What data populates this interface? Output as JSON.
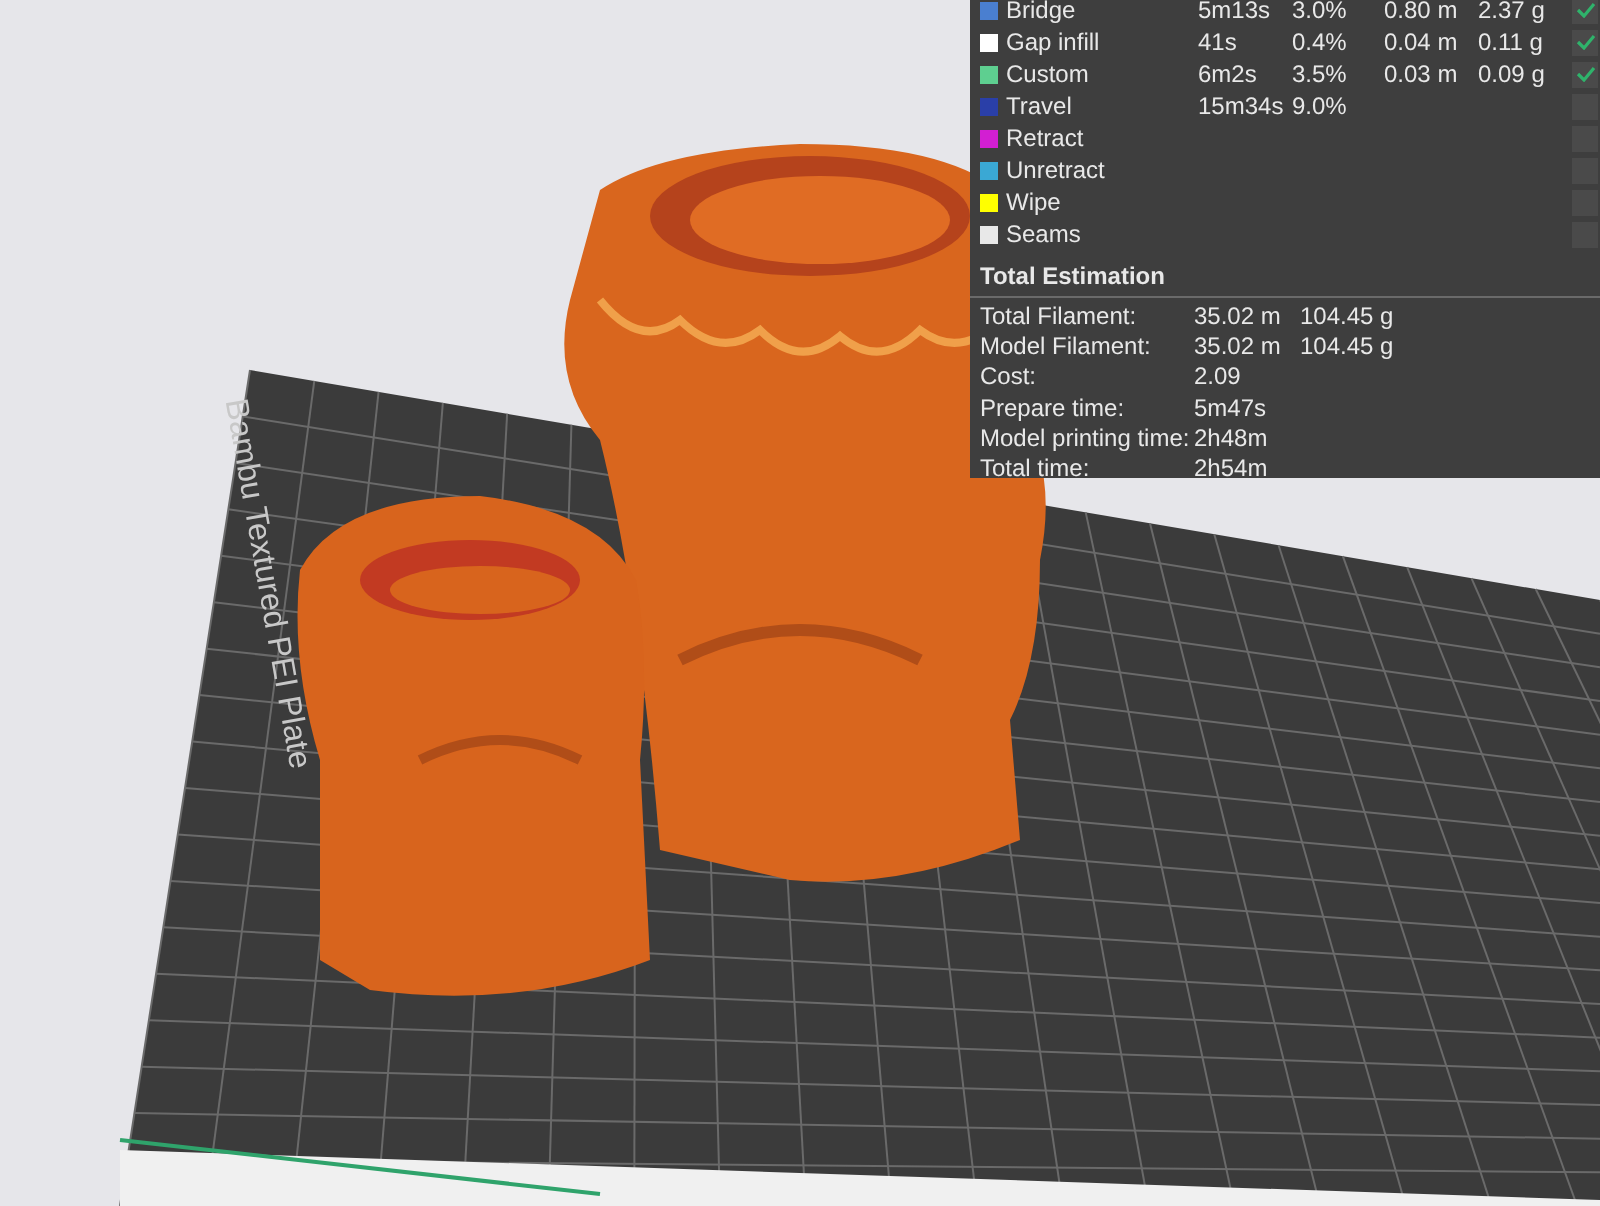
{
  "viewport": {
    "plate_label": "Bambu Textured PEI Plate"
  },
  "legend": {
    "rows": [
      {
        "name": "Bridge",
        "color": "#4a7fd0",
        "time": "5m13s",
        "percent": "3.0%",
        "length": "0.80 m",
        "weight": "2.37 g",
        "checked": true
      },
      {
        "name": "Gap infill",
        "color": "#ffffff",
        "time": "41s",
        "percent": "0.4%",
        "length": "0.04 m",
        "weight": "0.11 g",
        "checked": true
      },
      {
        "name": "Custom",
        "color": "#5ecf90",
        "time": "6m2s",
        "percent": "3.5%",
        "length": "0.03 m",
        "weight": "0.09 g",
        "checked": true
      },
      {
        "name": "Travel",
        "color": "#2a3fa8",
        "time": "15m34s",
        "percent": "9.0%",
        "checked": false
      },
      {
        "name": "Retract",
        "color": "#d21fd2",
        "checked": false
      },
      {
        "name": "Unretract",
        "color": "#3aa8d4",
        "checked": false
      },
      {
        "name": "Wipe",
        "color": "#ffff00",
        "checked": false
      },
      {
        "name": "Seams",
        "color": "#e8e8e8",
        "checked": false
      }
    ]
  },
  "total_estimation": {
    "title": "Total Estimation",
    "rows": [
      {
        "label": "Total Filament:",
        "value": "35.02 m",
        "weight": "104.45 g"
      },
      {
        "label": "Model Filament:",
        "value": "35.02 m",
        "weight": "104.45 g"
      },
      {
        "label": "Cost:",
        "value": "2.09"
      },
      {
        "label": "Prepare time:",
        "value": "5m47s"
      },
      {
        "label": "Model printing time:",
        "value": "2h48m"
      },
      {
        "label": "Total time:",
        "value": "2h54m"
      }
    ]
  }
}
